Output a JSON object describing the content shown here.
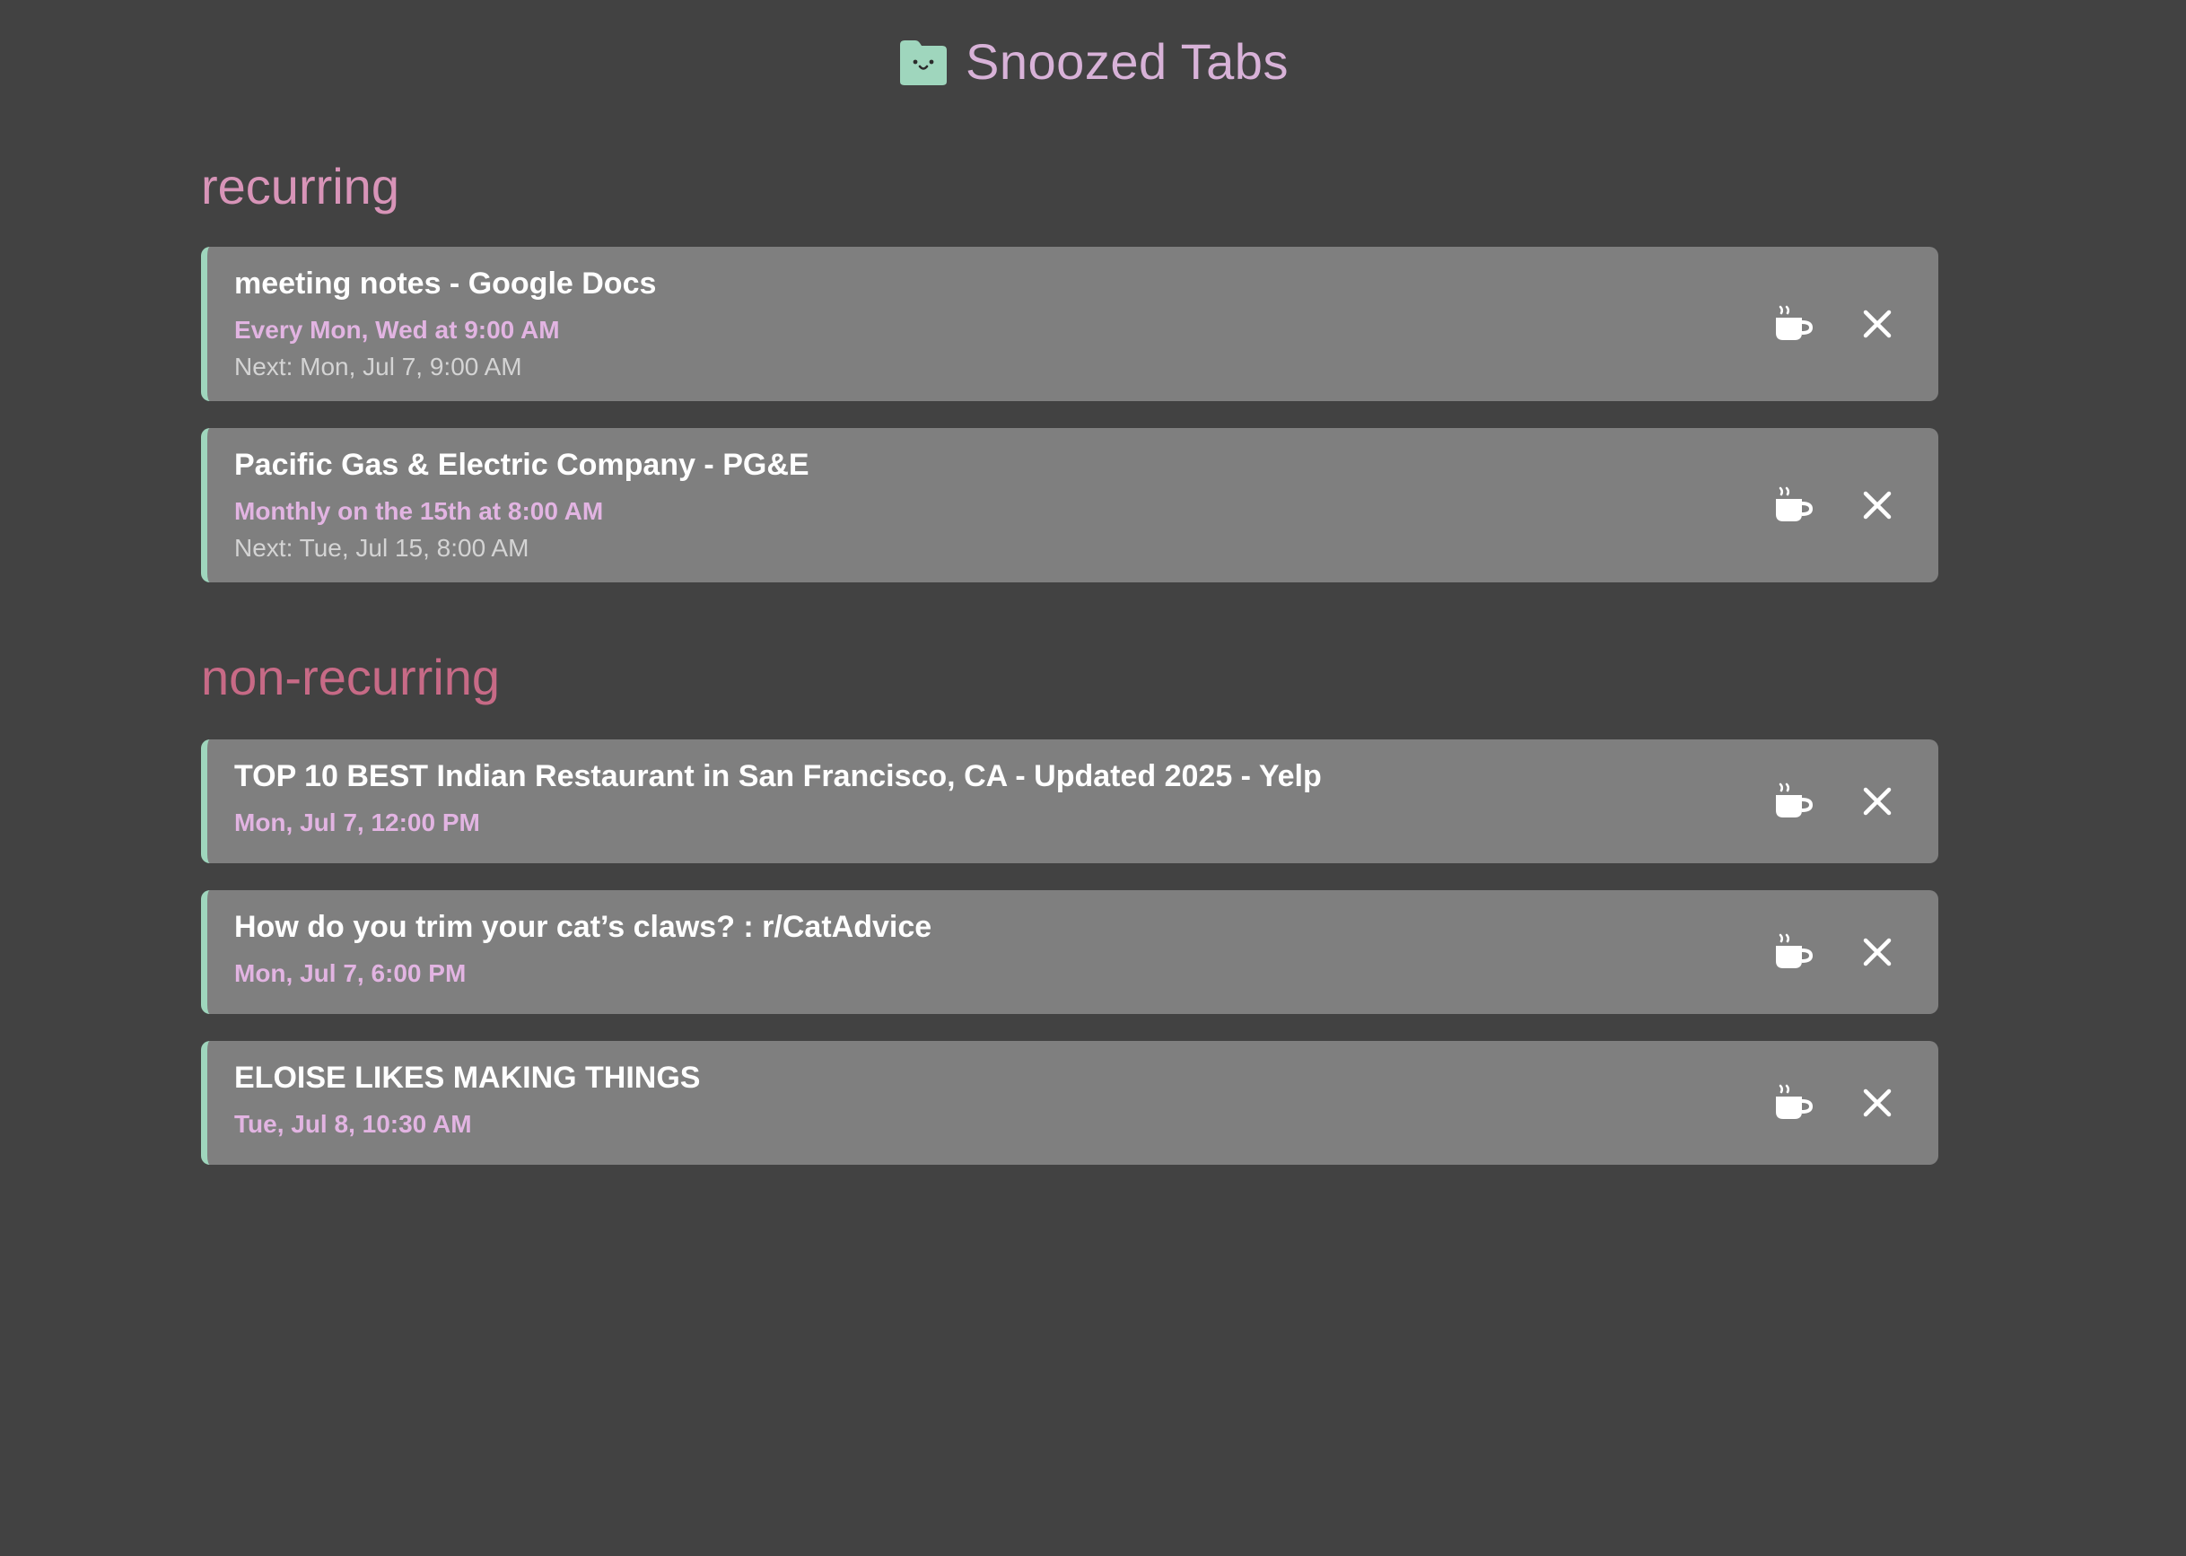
{
  "header": {
    "title": "Snoozed Tabs",
    "icon": "folder-face-icon",
    "accent_color": "#d8b2d8"
  },
  "sections": {
    "recurring": {
      "title": "recurring",
      "color": "#d894b8",
      "items": [
        {
          "title": "meeting notes - Google Docs",
          "schedule": "Every Mon, Wed at 9:00 AM",
          "next": "Next: Mon, Jul 7, 9:00 AM"
        },
        {
          "title": "Pacific Gas & Electric Company - PG&E",
          "schedule": "Monthly on the 15th at 8:00 AM",
          "next": "Next: Tue, Jul 15, 8:00 AM"
        }
      ]
    },
    "nonrecurring": {
      "title": "non-recurring",
      "color": "#c76a86",
      "items": [
        {
          "title": "TOP 10 BEST Indian Restaurant in San Francisco, CA - Updated 2025 - Yelp",
          "schedule": "Mon, Jul 7, 12:00 PM"
        },
        {
          "title": "How do you trim your cat’s claws? : r/CatAdvice",
          "schedule": "Mon, Jul 7, 6:00 PM"
        },
        {
          "title": "ELOISE LIKES MAKING THINGS",
          "schedule": "Tue, Jul 8, 10:30 AM"
        }
      ]
    }
  },
  "actions": {
    "wake_icon": "coffee-cup-icon",
    "delete_icon": "close-icon"
  },
  "colors": {
    "background": "#424242",
    "card": "#7f7f7f",
    "card_accent": "#9fd6bd",
    "schedule_text": "#e2b4e2"
  }
}
